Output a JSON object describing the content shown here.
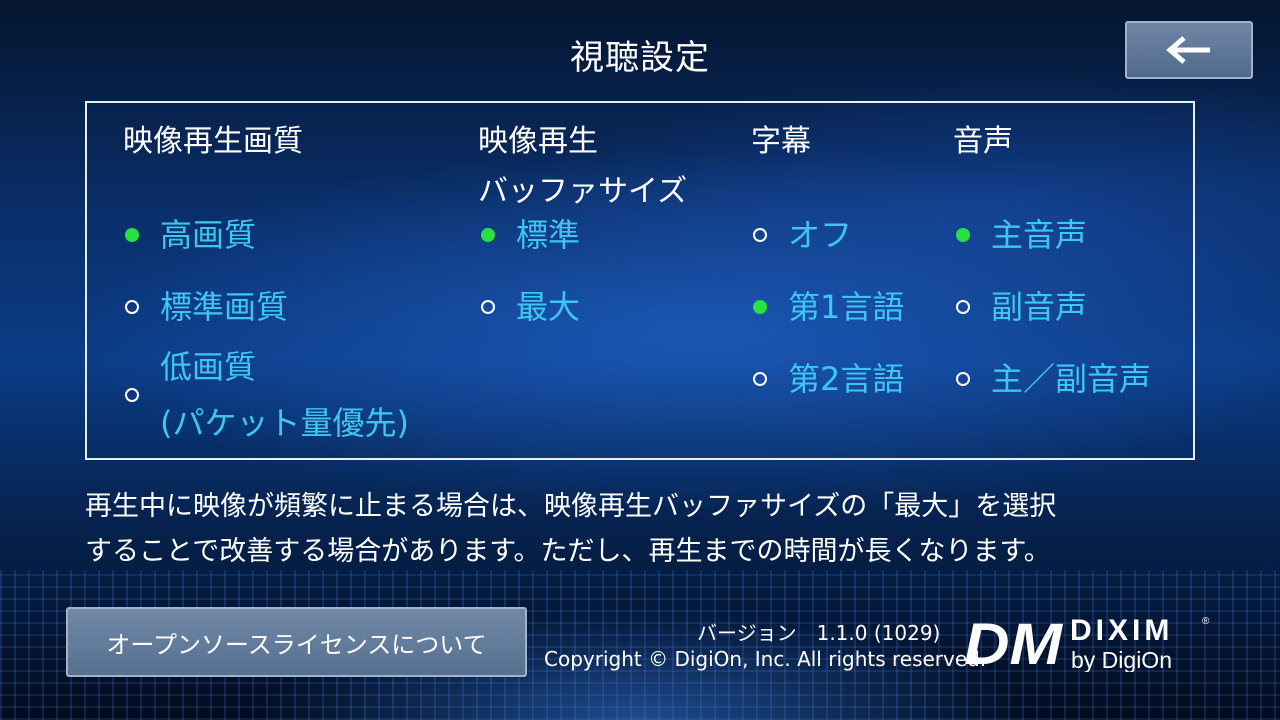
{
  "header": {
    "title": "視聴設定",
    "back_icon": "arrow-left-icon"
  },
  "settings": {
    "video_quality": {
      "title": "映像再生画質",
      "options": [
        {
          "label": "高画質",
          "selected": true
        },
        {
          "label": "標準画質",
          "selected": false
        },
        {
          "label_line1": "低画質",
          "label_line2": "(パケット量優先)",
          "selected": false
        }
      ]
    },
    "buffer_size": {
      "title_line1": "映像再生",
      "title_line2": "バッファサイズ",
      "options": [
        {
          "label": "標準",
          "selected": true
        },
        {
          "label": "最大",
          "selected": false
        }
      ]
    },
    "subtitles": {
      "title": "字幕",
      "options": [
        {
          "label": "オフ",
          "selected": false
        },
        {
          "label": "第1言語",
          "selected": true
        },
        {
          "label": "第2言語",
          "selected": false
        }
      ]
    },
    "audio": {
      "title": "音声",
      "options": [
        {
          "label": "主音声",
          "selected": true
        },
        {
          "label": "副音声",
          "selected": false
        },
        {
          "label": "主／副音声",
          "selected": false
        }
      ]
    }
  },
  "note": {
    "line1": "再生中に映像が頻繁に止まる場合は、映像再生バッファサイズの「最大」を選択",
    "line2": "することで改善する場合があります。ただし、再生までの時間が長くなります。"
  },
  "footer": {
    "oss_button": "オープンソースライセンスについて",
    "version": "バージョン　1.1.0 (1029)",
    "copyright": "Copyright © DigiOn, Inc. All rights reserved.",
    "logo": {
      "mark": "DM",
      "brand": "DIXIM",
      "registered": "®",
      "tagline": "by DigiOn"
    }
  },
  "colors": {
    "selected_dot": "#27e23e",
    "option_text": "#3ec6f2"
  }
}
